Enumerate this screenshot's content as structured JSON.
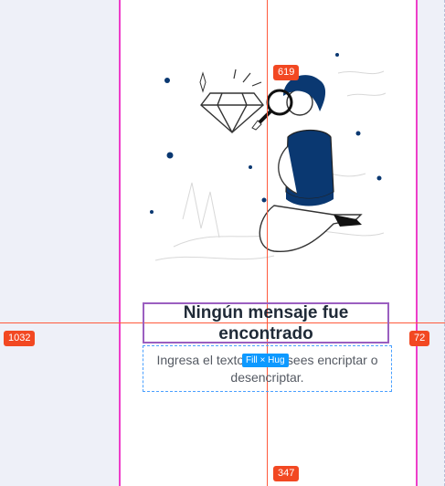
{
  "canvas": {
    "frame_label_top": "619",
    "frame_label_bottom": "347",
    "left_measure": "1032",
    "right_measure": "72",
    "sizing_badge": "Fill × Hug"
  },
  "empty_state": {
    "title": "Ningún mensaje fue encontrado",
    "subtitle": "Ingresa el texto que desees encriptar o desencriptar."
  },
  "colors": {
    "accent_magenta": "#ee3ec9",
    "guide_red": "#ff5a3c",
    "badge_red": "#f24822",
    "selection_blue": "#0d99ff",
    "illustration_navy": "#0a3871"
  }
}
